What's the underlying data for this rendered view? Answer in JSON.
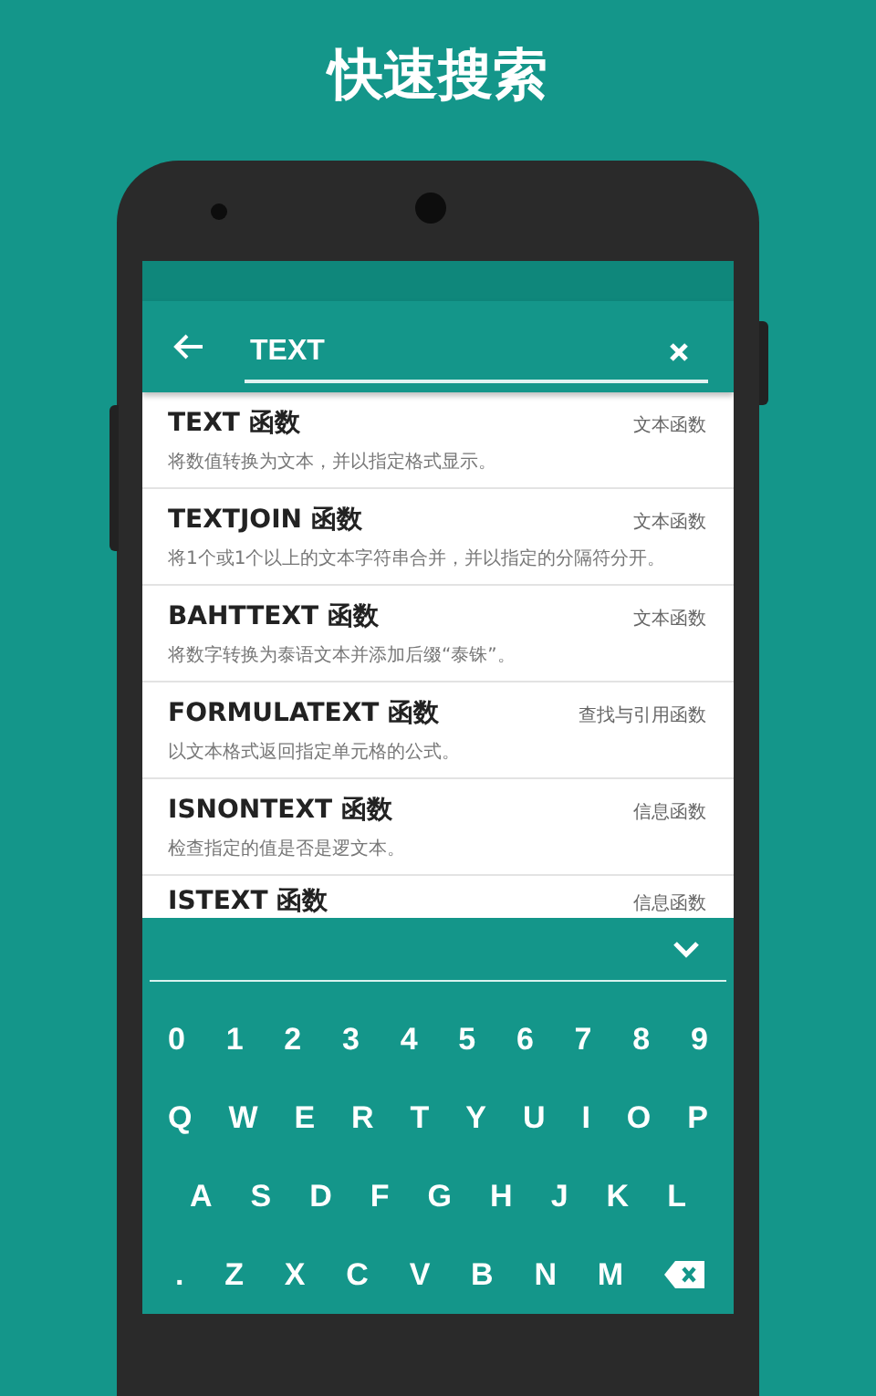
{
  "title": "快速搜索",
  "search": {
    "value": "TEXT"
  },
  "results": [
    {
      "name": "TEXT 函数",
      "category": "文本函数",
      "description": "将数值转换为文本，并以指定格式显示。"
    },
    {
      "name": "TEXTJOIN 函数",
      "category": "文本函数",
      "description": "将1个或1个以上的文本字符串合并，并以指定的分隔符分开。"
    },
    {
      "name": "BAHTTEXT 函数",
      "category": "文本函数",
      "description": "将数字转换为泰语文本并添加后缀“泰铢”。"
    },
    {
      "name": "FORMULATEXT 函数",
      "category": "查找与引用函数",
      "description": "以文本格式返回指定单元格的公式。"
    },
    {
      "name": "ISNONTEXT 函数",
      "category": "信息函数",
      "description": "检查指定的值是否是逻文本。"
    },
    {
      "name": "ISTEXT 函数",
      "category": "信息函数"
    }
  ],
  "keyboard": {
    "rows": [
      [
        {
          "kind": "char",
          "label": "0"
        },
        {
          "kind": "char",
          "label": "1"
        },
        {
          "kind": "char",
          "label": "2"
        },
        {
          "kind": "char",
          "label": "3"
        },
        {
          "kind": "char",
          "label": "4"
        },
        {
          "kind": "char",
          "label": "5"
        },
        {
          "kind": "char",
          "label": "6"
        },
        {
          "kind": "char",
          "label": "7"
        },
        {
          "kind": "char",
          "label": "8"
        },
        {
          "kind": "char",
          "label": "9"
        }
      ],
      [
        {
          "kind": "char",
          "label": "Q"
        },
        {
          "kind": "char",
          "label": "W"
        },
        {
          "kind": "char",
          "label": "E"
        },
        {
          "kind": "char",
          "label": "R"
        },
        {
          "kind": "char",
          "label": "T"
        },
        {
          "kind": "char",
          "label": "Y"
        },
        {
          "kind": "char",
          "label": "U"
        },
        {
          "kind": "char",
          "label": "I"
        },
        {
          "kind": "char",
          "label": "O"
        },
        {
          "kind": "char",
          "label": "P"
        }
      ],
      [
        {
          "kind": "char",
          "label": "A"
        },
        {
          "kind": "char",
          "label": "S"
        },
        {
          "kind": "char",
          "label": "D"
        },
        {
          "kind": "char",
          "label": "F"
        },
        {
          "kind": "char",
          "label": "G"
        },
        {
          "kind": "char",
          "label": "H"
        },
        {
          "kind": "char",
          "label": "J"
        },
        {
          "kind": "char",
          "label": "K"
        },
        {
          "kind": "char",
          "label": "L"
        }
      ],
      [
        {
          "kind": "char",
          "label": "."
        },
        {
          "kind": "char",
          "label": "Z"
        },
        {
          "kind": "char",
          "label": "X"
        },
        {
          "kind": "char",
          "label": "C"
        },
        {
          "kind": "char",
          "label": "V"
        },
        {
          "kind": "char",
          "label": "B"
        },
        {
          "kind": "char",
          "label": "N"
        },
        {
          "kind": "char",
          "label": "M"
        },
        {
          "kind": "backspace"
        }
      ]
    ]
  }
}
